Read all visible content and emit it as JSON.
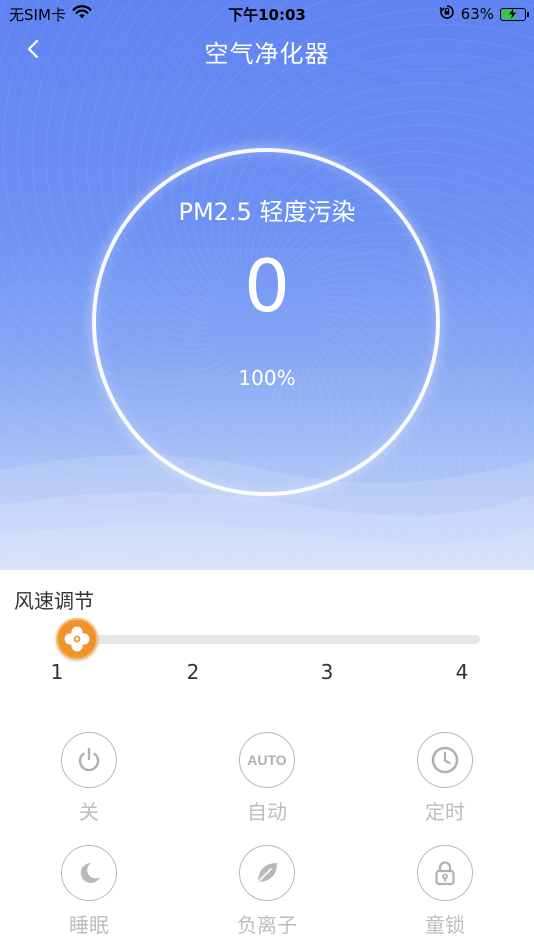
{
  "status_bar": {
    "carrier": "无SIM卡",
    "time": "下午10:03",
    "battery_percent": "63%",
    "battery_level": 0.63
  },
  "nav": {
    "title": "空气净化器"
  },
  "air_quality": {
    "label": "PM2.5 轻度污染",
    "value": "0",
    "filter_percent": "100%"
  },
  "fan_speed": {
    "title": "风速调节",
    "ticks": [
      "1",
      "2",
      "3",
      "4"
    ],
    "current_level": 1
  },
  "controls": [
    {
      "label": "关",
      "icon": "power-icon"
    },
    {
      "label": "自动",
      "icon": "auto-icon",
      "icon_text": "AUTO"
    },
    {
      "label": "定时",
      "icon": "clock-icon"
    },
    {
      "label": "睡眠",
      "icon": "moon-icon"
    },
    {
      "label": "负离子",
      "icon": "leaf-icon"
    },
    {
      "label": "童锁",
      "icon": "lock-icon"
    }
  ],
  "colors": {
    "hero_blue": "#5f84f2",
    "accent_orange": "#f0932b",
    "battery_green": "#2ecc40",
    "control_gray": "#bdbdbd"
  }
}
